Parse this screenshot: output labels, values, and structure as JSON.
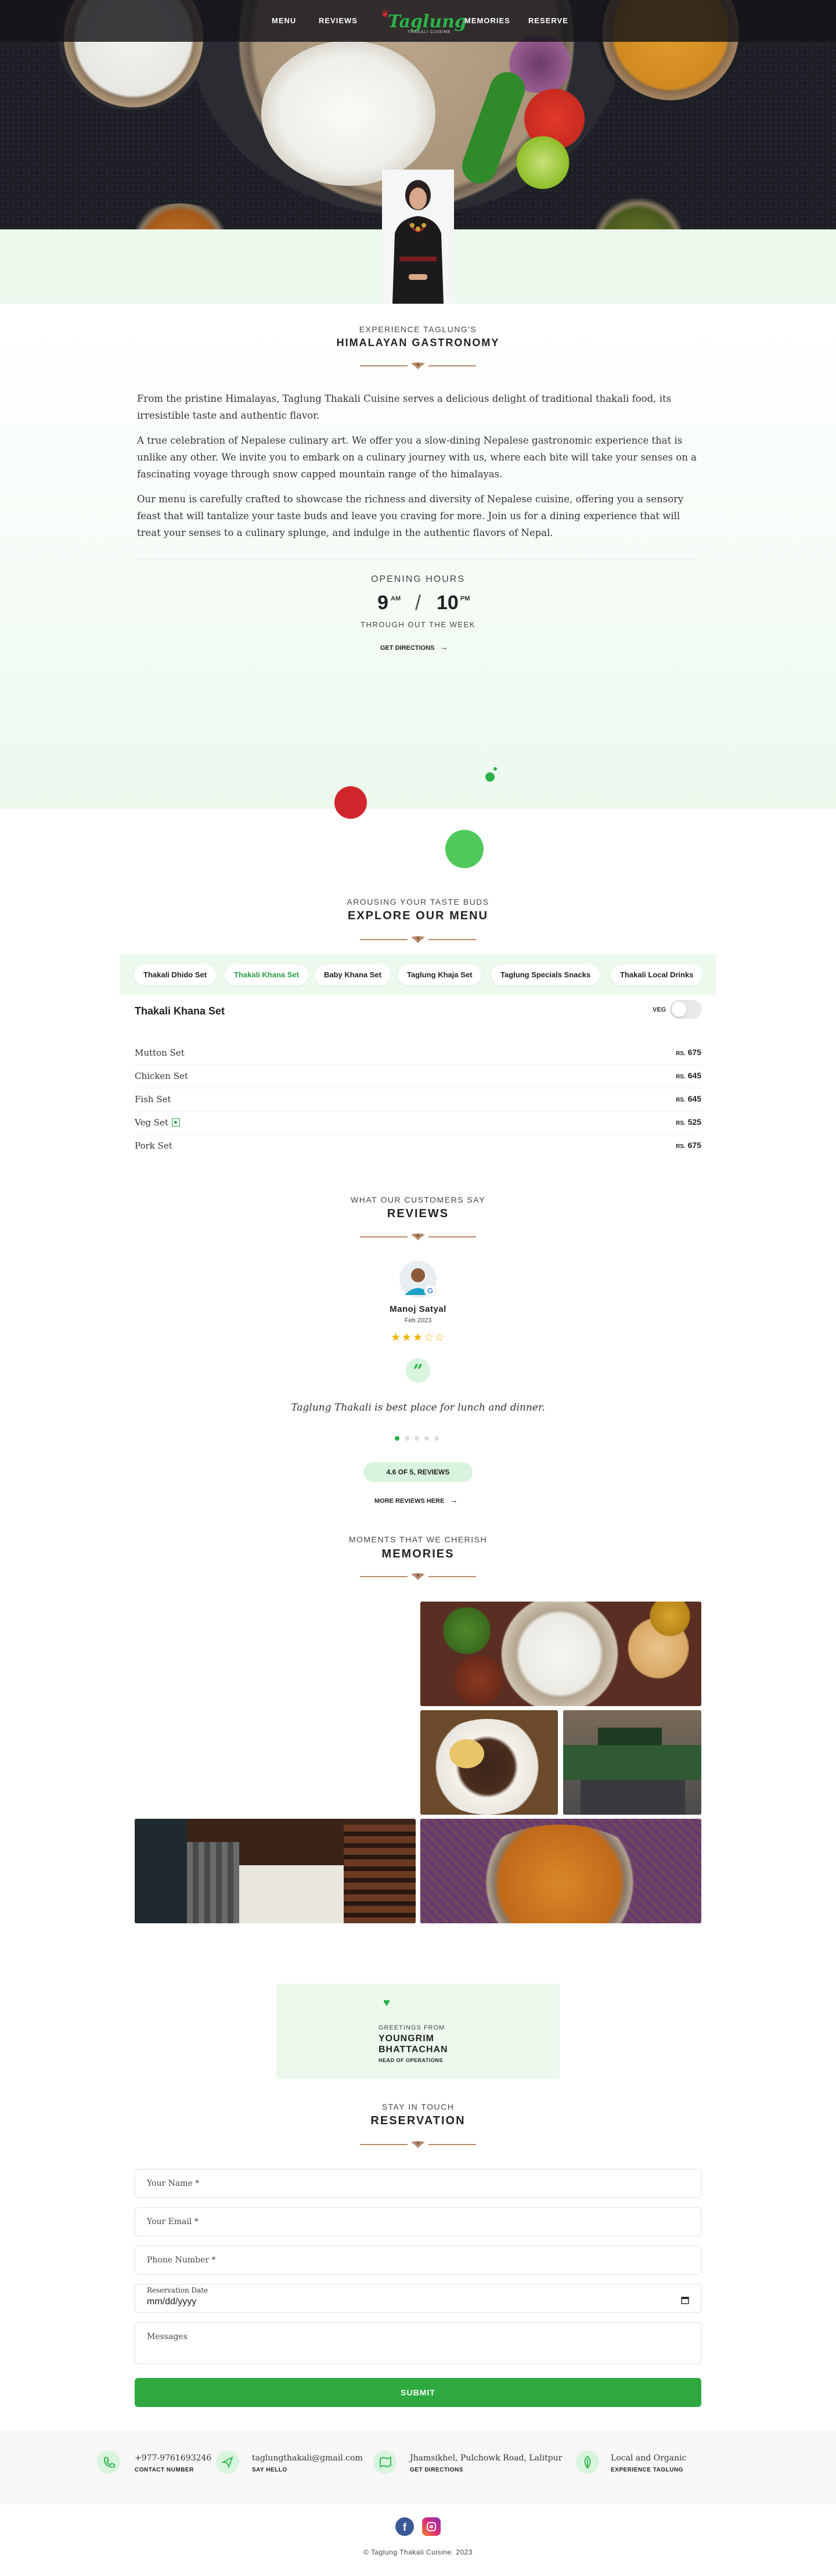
{
  "nav": {
    "items": [
      "MENU",
      "REVIEWS",
      "MEMORIES",
      "RESERVE"
    ],
    "logo_text": "Taglung",
    "logo_sub": "THAKALI CUISINE"
  },
  "about": {
    "kicker": "EXPERIENCE TAGLUNG'S",
    "heading": "HIMALAYAN GASTRONOMY",
    "paragraphs": [
      "From the pristine Himalayas, Taglung Thakali Cuisine serves a delicious delight of traditional thakali food, its irresistible taste and authentic flavor.",
      "A true celebration of Nepalese culinary art. We offer you a slow-dining Nepalese gastronomic experience that is unlike any other. We invite you to embark on a culinary journey with us, where each bite will take your senses on a fascinating voyage through snow capped mountain range of the himalayas.",
      "Our menu is carefully crafted to showcase the richness and diversity of Nepalese cuisine, offering you a sensory feast that will tantalize your taste buds and leave you craving for more. Join us for a dining experience that will treat your senses to a culinary splunge, and indulge in the authentic flavors of Nepal."
    ],
    "hours_label": "OPENING HOURS",
    "open_hour": "9",
    "open_suffix": "AM",
    "close_hour": "10",
    "close_suffix": "PM",
    "hours_sub": "THROUGH OUT THE WEEK",
    "directions": "GET DIRECTIONS"
  },
  "menu": {
    "kicker": "AROUSING YOUR TASTE BUDS",
    "heading": "EXPLORE OUR MENU",
    "tabs": [
      "Thakali Dhido Set",
      "Thakali Khana Set",
      "Baby Khana Set",
      "Taglung Khaja Set",
      "Taglung Specials Snacks",
      "Thakali Local Drinks"
    ],
    "active_tab": "Thakali Khana Set",
    "section_title": "Thakali Khana Set",
    "veg_label": "VEG",
    "veg_only": false,
    "items": [
      {
        "name": "Mutton Set",
        "currency": "RS.",
        "price": "675",
        "veg": false
      },
      {
        "name": "Chicken Set",
        "currency": "RS.",
        "price": "645",
        "veg": false
      },
      {
        "name": "Fish Set",
        "currency": "RS.",
        "price": "645",
        "veg": false
      },
      {
        "name": "Veg Set",
        "currency": "RS.",
        "price": "525",
        "veg": true
      },
      {
        "name": "Pork Set",
        "currency": "RS.",
        "price": "675",
        "veg": false
      }
    ]
  },
  "reviews": {
    "kicker": "WHAT OUR CUSTOMERS SAY",
    "heading": "REVIEWS",
    "reviewer": "Manoj Satyal",
    "date": "Feb 2023",
    "rating": 3,
    "max_rating": 5,
    "quote": "Taglung Thakali is best place for lunch and dinner.",
    "slide_count": 5,
    "active_slide": 1,
    "summary_badge": "4.6 OF 5, REVIEWS",
    "more_link": "MORE REVIEWS HERE"
  },
  "memories": {
    "kicker": "MOMENTS THAT WE CHERISH",
    "heading": "MEMORIES"
  },
  "greeting": {
    "label": "GREETINGS FROM",
    "name_line1": "YOUNGRIM",
    "name_line2": "BHATTACHAN",
    "role": "HEAD OF OPERATIONS"
  },
  "reservation": {
    "kicker": "STAY IN TOUCH",
    "heading": "RESERVATION",
    "name_placeholder": "Your Name *",
    "email_placeholder": "Your Email *",
    "phone_placeholder": "Phone Number *",
    "date_label": "Reservation Date",
    "date_placeholder": "mm/dd/yyyy",
    "messages_placeholder": "Messages",
    "submit": "SUBMIT"
  },
  "footer": {
    "contacts": [
      {
        "main": "+977-9761693246",
        "sub": "CONTACT NUMBER",
        "icon": "phone-icon"
      },
      {
        "main": "taglungthakali@gmail.com",
        "sub": "SAY HELLO",
        "icon": "send-icon"
      },
      {
        "main": "Jhamsikhel, Pulchowk Road, Lalitpur",
        "sub": "GET DIRECTIONS",
        "icon": "map-icon"
      },
      {
        "main": "Local and Organic",
        "sub": "EXPERIENCE TAGLUNG",
        "icon": "leaf-icon"
      }
    ],
    "copyright": "© Taglung Thakali Cuisine. 2023"
  },
  "colors": {
    "accent": "#2bb34a",
    "accent_light": "#ecfaee",
    "red": "#d1262b",
    "brown": "#b88a6a",
    "facebook": "#3b5998",
    "instagram": "#d62976"
  }
}
